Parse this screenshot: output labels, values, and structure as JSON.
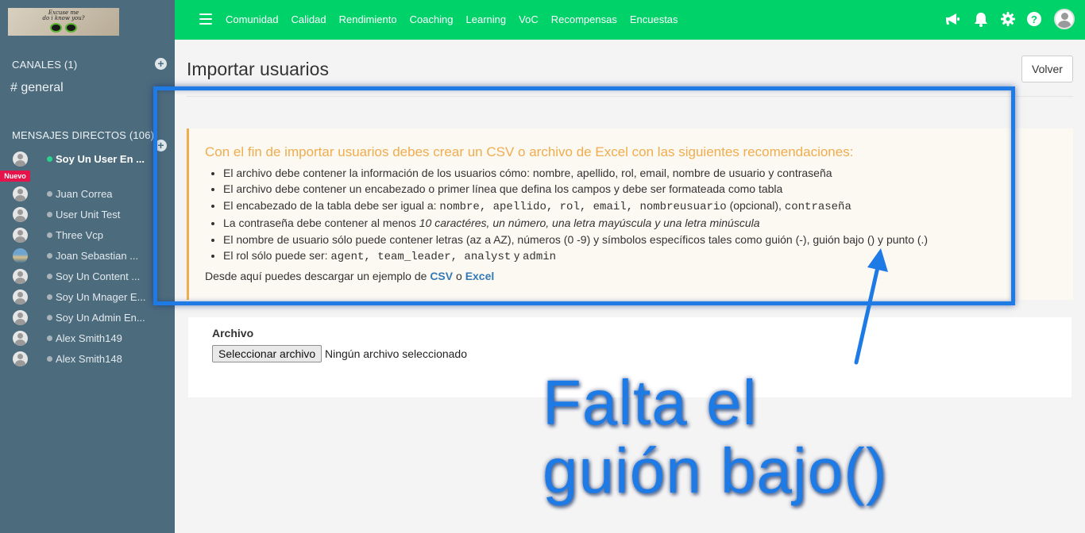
{
  "sidebar": {
    "logo_text": [
      "Excuse me",
      "do i know you?"
    ],
    "channels_header": "CANALES (1)",
    "channel": "# general",
    "dm_header": "MENSAJES DIRECTOS (106)",
    "nuevo_badge": "Nuevo",
    "dms": [
      {
        "name": "Soy Un User En ...",
        "online": true,
        "active": true
      },
      {
        "name": "Juan Correa",
        "online": false
      },
      {
        "name": "User Unit Test",
        "online": false
      },
      {
        "name": "Three Vcp",
        "online": false
      },
      {
        "name": "Joan Sebastian ...",
        "online": false,
        "photo": true
      },
      {
        "name": "Soy Un Content ...",
        "online": false
      },
      {
        "name": "Soy Un Mnager E...",
        "online": false
      },
      {
        "name": "Soy Un Admin En...",
        "online": false
      },
      {
        "name": "Alex Smith149",
        "online": false
      },
      {
        "name": "Alex Smith148",
        "online": false
      }
    ]
  },
  "topbar": {
    "nav": [
      "Comunidad",
      "Calidad",
      "Rendimiento",
      "Coaching",
      "Learning",
      "VoC",
      "Recompensas",
      "Encuestas"
    ],
    "icons": [
      "megaphone-icon",
      "bell-icon",
      "gear-icon",
      "help-icon",
      "user-avatar"
    ],
    "color": "#00d26a"
  },
  "page": {
    "title": "Importar usuarios",
    "back_button": "Volver"
  },
  "notice": {
    "title": "Con el fin de importar usuarios debes crear un CSV o archivo de Excel con las siguientes recomendaciones:",
    "item1": "El archivo debe contener la información de los usuarios cómo: nombre, apellido, rol, email, nombre de usuario y contraseña",
    "item2": "El archivo debe contener un encabezado o primer línea que defina los campos y debe ser formateada como tabla",
    "item3_prefix": "El encabezado de la tabla debe ser igual a: ",
    "item3_fields": "nombre, apellido, rol, email, nombreusuario",
    "item3_optional": " (opcional), ",
    "item3_password": "contraseña",
    "item4_prefix": "La contraseña debe contener al menos ",
    "item4_rule": "10 caractéres, un número, una letra mayúscula y una letra minúscula",
    "item5": "El nombre de usuario sólo puede contener letras (az a AZ), números (0 -9) y símbolos específicos tales como guión (-), guión bajo () y punto (.)",
    "item6_prefix": "El rol sólo puede ser: ",
    "item6_roles": "agent, team_leader, analyst",
    "item6_and": " y ",
    "item6_last": "admin",
    "footer_prefix": "Desde aquí puedes descargar un ejemplo de ",
    "csv_link": "CSV",
    "footer_or": " o ",
    "excel_link": "Excel",
    "accent": "#f0ad4e"
  },
  "form": {
    "label": "Archivo",
    "file_button": "Seleccionar archivo",
    "file_status": "Ningún archivo seleccionado"
  },
  "annotation": {
    "line1": "Falta el",
    "line2": "guión bajo()",
    "color": "#1e7be6"
  }
}
